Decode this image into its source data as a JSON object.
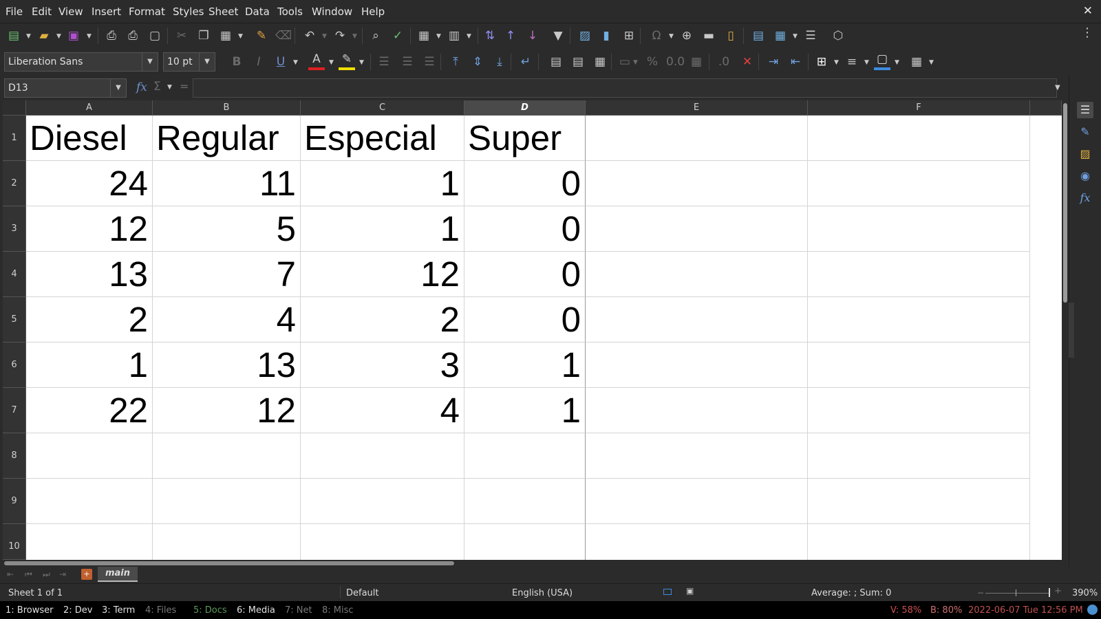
{
  "menubar": {
    "items": [
      "File",
      "Edit",
      "View",
      "Insert",
      "Format",
      "Styles",
      "Sheet",
      "Data",
      "Tools",
      "Window",
      "Help"
    ],
    "close_glyph": "✕"
  },
  "toolbar": {
    "font_name": "Liberation Sans",
    "font_size": "10 pt",
    "font_color_accent": "#e02020",
    "highlight_color_accent": "#f0e000",
    "border_color_accent": "#3c8ce0"
  },
  "formula_bar": {
    "cell_ref": "D13",
    "fx_label": "fx",
    "sum_label": "Σ",
    "equals_label": "=",
    "formula": ""
  },
  "grid": {
    "columns": [
      "A",
      "B",
      "C",
      "D",
      "E",
      "F"
    ],
    "active_column": "D",
    "rows": [
      "1",
      "2",
      "3",
      "4",
      "5",
      "6",
      "7",
      "8",
      "9",
      "10"
    ],
    "header_row": [
      "Diesel",
      "Regular",
      "Especial",
      "Super"
    ],
    "data_rows": [
      [
        "24",
        "11",
        "1",
        "0"
      ],
      [
        "12",
        "5",
        "1",
        "0"
      ],
      [
        "13",
        "7",
        "12",
        "0"
      ],
      [
        "2",
        "4",
        "2",
        "0"
      ],
      [
        "1",
        "13",
        "3",
        "1"
      ],
      [
        "22",
        "12",
        "4",
        "1"
      ]
    ]
  },
  "sheet_tabs": {
    "active": "main"
  },
  "status": {
    "sheet_info": "Sheet 1 of 1",
    "page_style": "Default",
    "language": "English (USA)",
    "stats": "Average: ; Sum: 0",
    "zoom": "390%"
  },
  "taskbar": {
    "workspaces": [
      {
        "label": "1: Browser",
        "active": true
      },
      {
        "label": "2: Dev",
        "active": true
      },
      {
        "label": "3: Term",
        "active": true
      },
      {
        "label": "4: Files",
        "active": false
      },
      {
        "label": "5: Docs",
        "active": false
      },
      {
        "label": "6: Media",
        "active": true
      },
      {
        "label": "7: Net",
        "active": false
      },
      {
        "label": "8: Misc",
        "active": false
      }
    ],
    "volume": "V: 58%",
    "brightness": "B: 80%",
    "datetime": "2022-06-07 Tue 12:56 PM",
    "accent_colors": {
      "volume": "#d05050",
      "brightness": "#d07070",
      "datetime": "#c05050",
      "workspace_inactive": "#7a7a7a",
      "files_docs": "#5a9a5a"
    }
  }
}
